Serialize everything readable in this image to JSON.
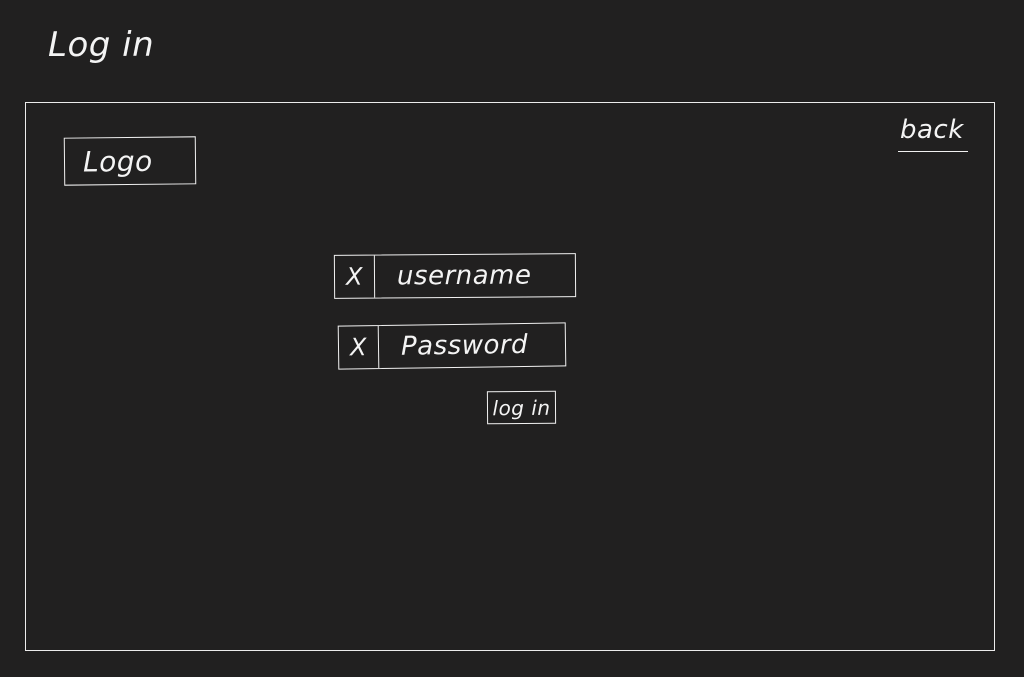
{
  "page": {
    "title": "Log in"
  },
  "header": {
    "logo_text": "Logo",
    "back_label": "back"
  },
  "form": {
    "username": {
      "icon": "X",
      "placeholder": "username"
    },
    "password": {
      "icon": "X",
      "placeholder": "Password"
    },
    "submit_label": "log in"
  },
  "colors": {
    "background": "#212020",
    "stroke": "#f1f1f1",
    "text": "#f4f4f4"
  }
}
